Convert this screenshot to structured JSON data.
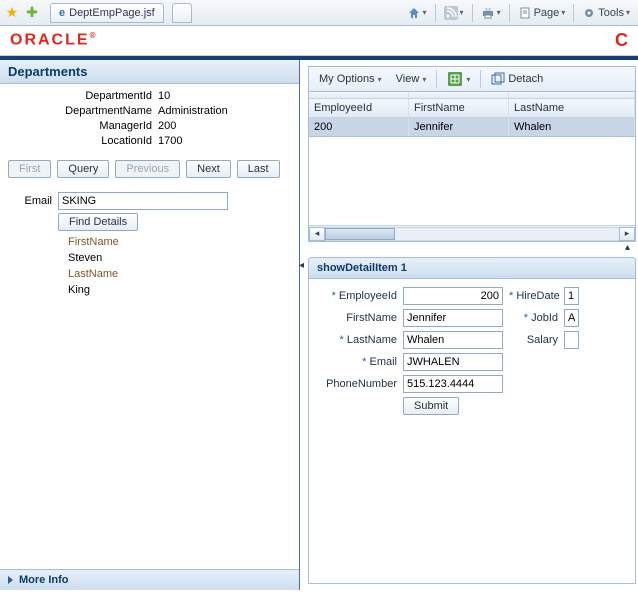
{
  "browser": {
    "tab_title": "DeptEmpPage.jsf",
    "page_label": "Page",
    "tools_label": "Tools"
  },
  "brand": {
    "name": "ORACLE",
    "reg": "®"
  },
  "departments": {
    "header": "Departments",
    "labels": {
      "id": "DepartmentId",
      "name": "DepartmentName",
      "mgr": "ManagerId",
      "loc": "LocationId"
    },
    "values": {
      "id": "10",
      "name": "Administration",
      "mgr": "200",
      "loc": "1700"
    },
    "nav": {
      "first": "First",
      "query": "Query",
      "previous": "Previous",
      "next": "Next",
      "last": "Last"
    }
  },
  "email_search": {
    "label": "Email",
    "value": "SKING",
    "find_btn": "Find Details",
    "results": {
      "fn_label": "FirstName",
      "fn_value": "Steven",
      "ln_label": "LastName",
      "ln_value": "King"
    }
  },
  "more_info": "More Info",
  "toolbar": {
    "my_options": "My Options",
    "view": "View",
    "detach": "Detach"
  },
  "grid": {
    "cols": {
      "emp": "EmployeeId",
      "fn": "FirstName",
      "ln": "LastName"
    },
    "row": {
      "emp": "200",
      "fn": "Jennifer",
      "ln": "Whalen"
    }
  },
  "detail": {
    "header": "showDetailItem 1",
    "labels": {
      "emp": "EmployeeId",
      "fn": "FirstName",
      "ln": "LastName",
      "em": "Email",
      "ph": "PhoneNumber",
      "hire": "HireDate",
      "job": "JobId",
      "salary": "Salary"
    },
    "values": {
      "emp": "200",
      "fn": "Jennifer",
      "ln": "Whalen",
      "em": "JWHALEN",
      "ph": "515.123.4444",
      "hire": "1",
      "job": "A",
      "salary": ""
    },
    "submit": "Submit"
  }
}
